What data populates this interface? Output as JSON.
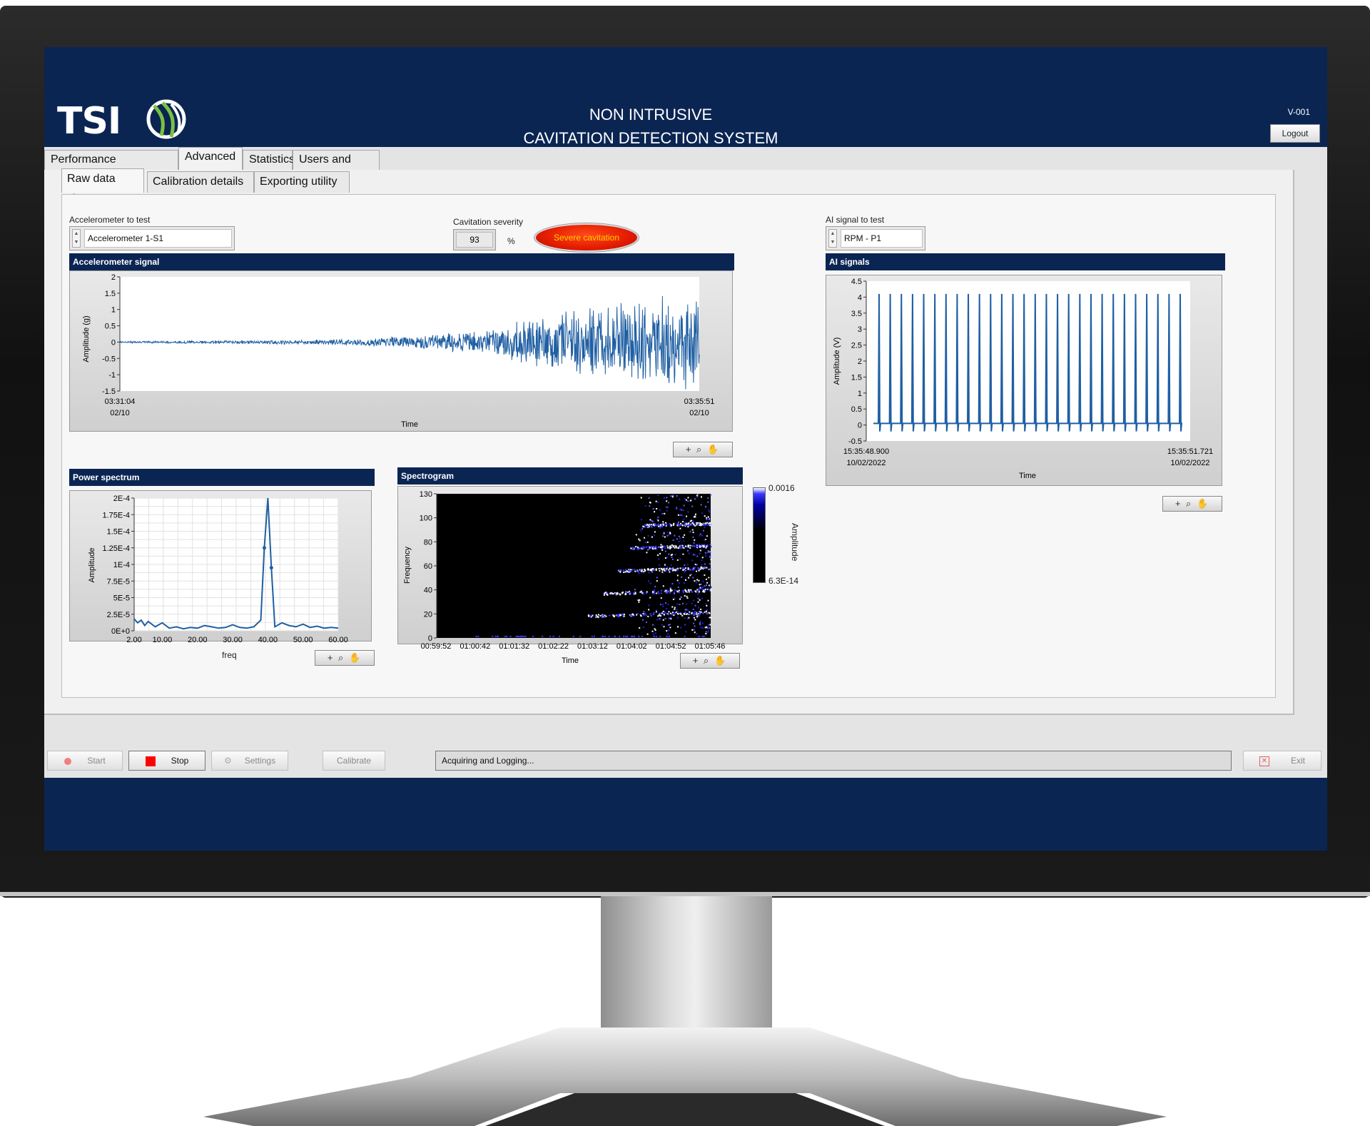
{
  "header": {
    "logo_text": "TSI",
    "title_line1": "NON INTRUSIVE",
    "title_line2": "CAVITATION DETECTION SYSTEM",
    "version": "V-001",
    "logout_label": "Logout"
  },
  "tabs": [
    {
      "label": "Performance monitoring"
    },
    {
      "label": "Advanced"
    },
    {
      "label": "Statistics"
    },
    {
      "label": "Users and roles"
    }
  ],
  "subtabs": [
    {
      "label": "Raw data view"
    },
    {
      "label": "Calibration details"
    },
    {
      "label": "Exporting utility"
    }
  ],
  "controls": {
    "accelerometer_label": "Accelerometer to test",
    "accelerometer_value": "Accelerometer 1-S1",
    "severity_label": "Cavitation severity",
    "severity_value": "93",
    "severity_unit": "%",
    "severity_indicator": "Severe cavitation",
    "ai_label": "AI signal to test",
    "ai_value": "RPM - P1"
  },
  "colors": {
    "navy": "#0b2553",
    "trace": "#1f5fa3",
    "indicator": "#e31b00"
  },
  "graphs": {
    "accel": {
      "title": "Accelerometer signal",
      "ylabel": "Amplitude (g)",
      "xlabel": "Time",
      "yticks": [
        "2",
        "1.5",
        "1",
        "0.5",
        "0",
        "-0.5",
        "-1",
        "-1.5"
      ],
      "xstart_time": "03:31:04",
      "xstart_date": "02/10",
      "xend_time": "03:35:51",
      "xend_date": "02/10"
    },
    "ai": {
      "title": "AI signals",
      "ylabel": "Amplitude (V)",
      "xlabel": "Time",
      "yticks": [
        "4.5",
        "4",
        "3.5",
        "3",
        "2.5",
        "2",
        "1.5",
        "1",
        "0.5",
        "0",
        "-0.5"
      ],
      "xstart_time": "15:35:48.900",
      "xstart_date": "10/02/2022",
      "xend_time": "15:35:51.721",
      "xend_date": "10/02/2022"
    },
    "power": {
      "title": "Power spectrum",
      "ylabel": "Amplitude",
      "xlabel": "freq",
      "yticks": [
        "2E-4",
        "1.75E-4",
        "1.5E-4",
        "1.25E-4",
        "1E-4",
        "7.5E-5",
        "5E-5",
        "2.5E-5",
        "0E+0"
      ],
      "xticks": [
        "2.00",
        "10.00",
        "20.00",
        "30.00",
        "40.00",
        "50.00",
        "60.00"
      ]
    },
    "spectrogram": {
      "title": "Spectrogram",
      "ylabel": "Frequency",
      "xlabel": "Time",
      "yticks": [
        "130",
        "100",
        "80",
        "60",
        "40",
        "20",
        "0"
      ],
      "xticks": [
        "00:59:52",
        "01:00:42",
        "01:01:32",
        "01:02:22",
        "01:03:12",
        "01:04:02",
        "01:04:52",
        "01:05:46"
      ],
      "scale_max": "0.0016",
      "scale_min": "6.3E-14",
      "scale_label": "Amplitude"
    },
    "palette_glyphs": "+ ⌕ ✋"
  },
  "chart_data": [
    {
      "type": "line",
      "title": "Accelerometer signal",
      "xlabel": "Time",
      "ylabel": "Amplitude (g)",
      "x_range": [
        "03:31:04",
        "03:35:51"
      ],
      "ylim": [
        -1.5,
        2
      ],
      "envelope": {
        "x_fraction": [
          0.0,
          0.2,
          0.4,
          0.5,
          0.6,
          0.65,
          0.7,
          0.75,
          0.8,
          0.85,
          0.9,
          0.95,
          1.0
        ],
        "amplitude": [
          0.03,
          0.05,
          0.1,
          0.2,
          0.35,
          0.5,
          0.7,
          0.9,
          1.1,
          1.2,
          1.3,
          1.5,
          1.6
        ]
      }
    },
    {
      "type": "line",
      "title": "AI signals",
      "xlabel": "Time",
      "ylabel": "Amplitude (V)",
      "x_range": [
        "15:35:48.900",
        "15:35:51.721"
      ],
      "ylim": [
        -0.5,
        4.5
      ],
      "pulse_count": 28,
      "baseline": 0.05,
      "pulse_height": 4.1
    },
    {
      "type": "line",
      "title": "Power spectrum",
      "xlabel": "freq",
      "ylabel": "Amplitude",
      "xlim": [
        2,
        60
      ],
      "ylim": [
        0,
        0.0002
      ],
      "x": [
        2,
        3,
        4,
        5,
        6,
        8,
        10,
        12,
        14,
        16,
        18,
        20,
        22,
        24,
        26,
        28,
        30,
        32,
        34,
        36,
        38,
        39,
        40,
        41,
        42,
        44,
        46,
        48,
        50,
        52,
        54,
        56,
        58,
        60
      ],
      "y": [
        1.8e-05,
        1.2e-05,
        1.6e-05,
        8e-06,
        1.4e-05,
        6e-06,
        1.2e-05,
        4e-06,
        6e-06,
        3e-06,
        5e-06,
        4e-06,
        8e-06,
        6e-06,
        4e-06,
        5e-06,
        9e-06,
        5e-06,
        4e-06,
        6e-06,
        1.6e-05,
        0.000125,
        0.0002,
        9.5e-05,
        6e-06,
        1.2e-05,
        8e-06,
        6e-06,
        1e-05,
        5e-06,
        7e-06,
        4e-06,
        5e-06,
        4e-06
      ]
    },
    {
      "type": "heatmap",
      "title": "Spectrogram",
      "xlabel": "Time",
      "ylabel": "Frequency",
      "ylim": [
        0,
        130
      ],
      "color_range": [
        6.3e-14,
        0.0016
      ],
      "bands_hz": [
        20,
        40,
        60,
        80,
        100
      ]
    }
  ],
  "bottom": {
    "start_label": "Start",
    "stop_label": "Stop",
    "settings_label": "Settings",
    "calibrate_label": "Calibrate",
    "status_text": "Acquiring and Logging...",
    "exit_label": "Exit"
  }
}
